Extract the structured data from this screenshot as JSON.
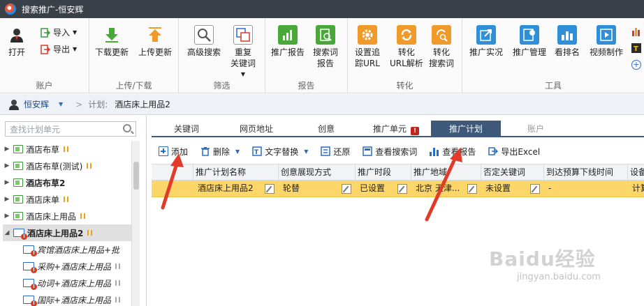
{
  "window": {
    "title": "搜索推广-恒安辉"
  },
  "ribbon": {
    "account": {
      "label": "账户",
      "open": "打开",
      "import": "导入",
      "export": "导出"
    },
    "updown": {
      "label": "上传/下载",
      "download": "下载更新",
      "upload": "上传更新"
    },
    "filter": {
      "label": "筛选",
      "advsearch": "高级搜索",
      "dup_line1": "重复",
      "dup_line2": "关键词"
    },
    "report": {
      "label": "报告",
      "promo_report": "推广报告",
      "searchword_line1": "搜索词",
      "searchword_line2": "报告"
    },
    "convert": {
      "label": "转化",
      "track_line1": "设置追",
      "track_line2": "踪URL",
      "url_line1": "转化",
      "url_line2": "URL解析",
      "sw_line1": "转化",
      "sw_line2": "搜索词"
    },
    "tools": {
      "label": "工具",
      "realtime": "推广实况",
      "manage": "推广管理",
      "rank": "看排名",
      "video": "视频制作"
    }
  },
  "breadcrumb": {
    "user": "恒安辉",
    "separator": ">",
    "plan_label": "计划:",
    "plan_name": "酒店床上用品2"
  },
  "sidebar": {
    "search_placeholder": "查找计划单元",
    "items": [
      {
        "label": "酒店布草"
      },
      {
        "label": "酒店布草(测试)"
      },
      {
        "label": "酒店布草2"
      },
      {
        "label": "酒店床单"
      },
      {
        "label": "酒店床上用品"
      },
      {
        "label": "酒店床上用品2"
      },
      {
        "label": "宾馆酒店床上用品+批"
      },
      {
        "label": "采购+酒店床上用品"
      },
      {
        "label": "动词+酒店床上用品"
      },
      {
        "label": "国际+酒店床上用品"
      }
    ]
  },
  "tabs": [
    {
      "label": "关键词"
    },
    {
      "label": "网页地址"
    },
    {
      "label": "创意"
    },
    {
      "label": "推广单元",
      "badge": "!"
    },
    {
      "label": "推广计划"
    },
    {
      "label": "账户"
    }
  ],
  "toolbar": {
    "add": "添加",
    "delete": "删除",
    "replace": "文字替换",
    "restore": "还原",
    "view_search": "查看搜索词",
    "view_report": "查看报告",
    "export_excel": "导出Excel"
  },
  "grid": {
    "columns": [
      "推广计划名称",
      "创意展现方式",
      "推广时段",
      "推广地域",
      "否定关键词",
      "到达预算下线时间",
      "设备"
    ],
    "row": [
      "酒店床上用品2",
      "轮替",
      "已设置",
      "北京 天津...",
      "未设置",
      "-",
      "计算"
    ]
  },
  "watermark": {
    "brand": "Baidu经验",
    "url": "jingyan.baidu.com"
  },
  "colors": {
    "active_tab": "#3d5878",
    "selected_row": "#fdd66a",
    "annotation_arrow": "#e23b2a"
  }
}
